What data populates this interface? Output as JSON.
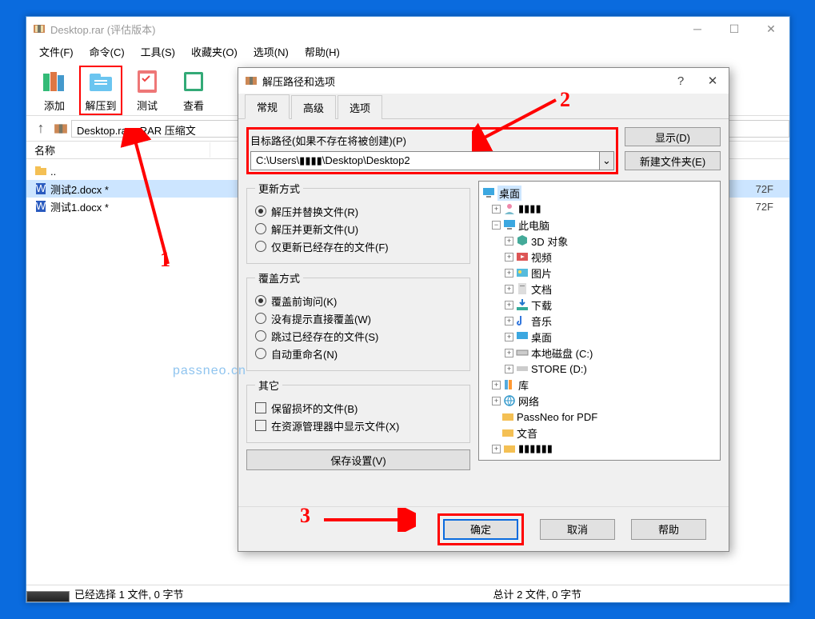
{
  "main": {
    "title": "Desktop.rar (评估版本)",
    "menus": [
      "文件(F)",
      "命令(C)",
      "工具(S)",
      "收藏夹(O)",
      "选项(N)",
      "帮助(H)"
    ],
    "toolbar": {
      "add": "添加",
      "extract_to": "解压到",
      "test": "测试",
      "view": "查看"
    },
    "address": "Desktop.rar - RAR 压缩文",
    "col_name": "名称",
    "files": {
      "parent": "..",
      "f1": "测试2.docx *",
      "f2": "测试1.docx *",
      "date": "72F"
    },
    "status_left": "已经选择 1 文件, 0 字节",
    "status_right": "总计 2 文件, 0 字节"
  },
  "dialog": {
    "title": "解压路径和选项",
    "help_q": "?",
    "tabs": {
      "general": "常规",
      "advanced": "高级",
      "options": "选项"
    },
    "path_label": "目标路径(如果不存在将被创建)(P)",
    "path_value": "C:\\Users\\▮▮▮▮\\Desktop\\Desktop2",
    "btn_display": "显示(D)",
    "btn_newfolder": "新建文件夹(E)",
    "grp_update": "更新方式",
    "upd1": "解压并替换文件(R)",
    "upd2": "解压并更新文件(U)",
    "upd3": "仅更新已经存在的文件(F)",
    "grp_overwrite": "覆盖方式",
    "ov1": "覆盖前询问(K)",
    "ov2": "没有提示直接覆盖(W)",
    "ov3": "跳过已经存在的文件(S)",
    "ov4": "自动重命名(N)",
    "grp_misc": "其它",
    "misc1": "保留损坏的文件(B)",
    "misc2": "在资源管理器中显示文件(X)",
    "save_settings": "保存设置(V)",
    "tree": {
      "desktop": "桌面",
      "user": "▮▮▮▮",
      "thispc": "此电脑",
      "obj3d": "3D 对象",
      "video": "视频",
      "pictures": "图片",
      "docs": "文档",
      "downloads": "下载",
      "music": "音乐",
      "desk": "桌面",
      "diskc": "本地磁盘 (C:)",
      "diskd": "STORE (D:)",
      "lib": "库",
      "network": "网络",
      "passneo": "PassNeo for PDF",
      "wenyin": "文音",
      "last": "▮▮▮▮▮▮"
    },
    "ok": "确定",
    "cancel": "取消",
    "help": "帮助"
  },
  "annotations": {
    "n1": "1",
    "n2": "2",
    "n3": "3"
  },
  "watermark": "passneo.cn"
}
